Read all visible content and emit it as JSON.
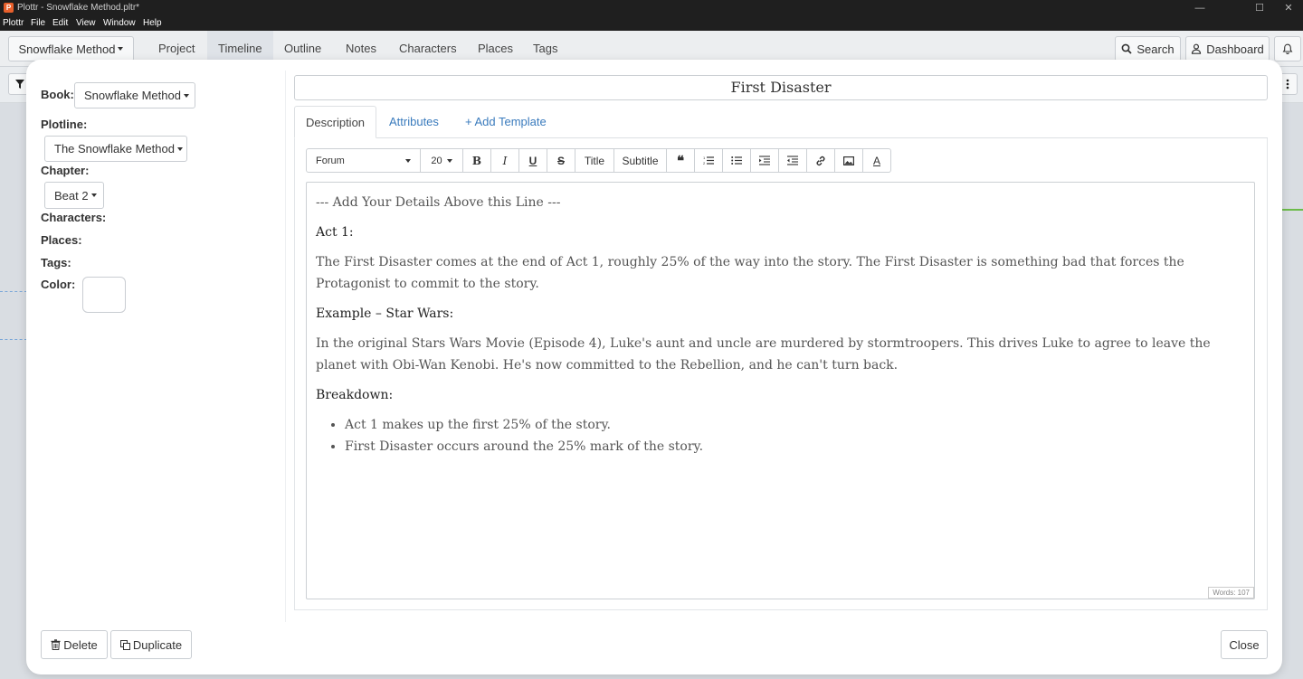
{
  "window": {
    "title": "Plottr - Snowflake Method.pltr*",
    "controls": {
      "min": "—",
      "max": "☐",
      "close": "✕"
    }
  },
  "menubar": [
    "Plottr",
    "File",
    "Edit",
    "View",
    "Window",
    "Help"
  ],
  "nav": {
    "project_dropdown": "Snowflake Method",
    "tabs": [
      "Project",
      "Timeline",
      "Outline",
      "Notes",
      "Characters",
      "Places",
      "Tags"
    ],
    "active_tab": "Timeline",
    "search_label": "Search",
    "dashboard_label": "Dashboard"
  },
  "sidebar": {
    "book_label": "Book:",
    "book_value": "Snowflake Method",
    "plotline_label": "Plotline:",
    "plotline_value": "The Snowflake Method",
    "chapter_label": "Chapter:",
    "chapter_value": "Beat 2",
    "characters_label": "Characters:",
    "places_label": "Places:",
    "tags_label": "Tags:",
    "color_label": "Color:"
  },
  "card": {
    "title": "First Disaster",
    "tabs": {
      "description": "Description",
      "attributes": "Attributes",
      "add_template": "+ Add Template"
    }
  },
  "editor_toolbar": {
    "font": "Forum",
    "size": "20",
    "title_btn": "Title",
    "subtitle_btn": "Subtitle"
  },
  "editor": {
    "line0": "--- Add Your Details Above this Line ---",
    "h_act1": "Act 1:",
    "p_act1": "The First Disaster comes at the end of Act 1, roughly 25% of the way into the story. The First Disaster is something bad that forces the Protagonist to commit to the story.",
    "h_example": "Example – Star Wars:",
    "p_example": "In the original Stars Wars Movie (Episode 4), Luke's aunt and uncle are murdered by stormtroopers. This drives Luke to agree to leave the planet with Obi-Wan Kenobi. He's now committed to the Rebellion, and he can't turn back.",
    "h_breakdown": "Breakdown:",
    "bullets": [
      "Act 1 makes up the first 25% of the story.",
      "First Disaster occurs around the 25% mark of the story."
    ],
    "word_count": "Words: 107"
  },
  "footer": {
    "delete": "Delete",
    "duplicate": "Duplicate",
    "close": "Close"
  }
}
